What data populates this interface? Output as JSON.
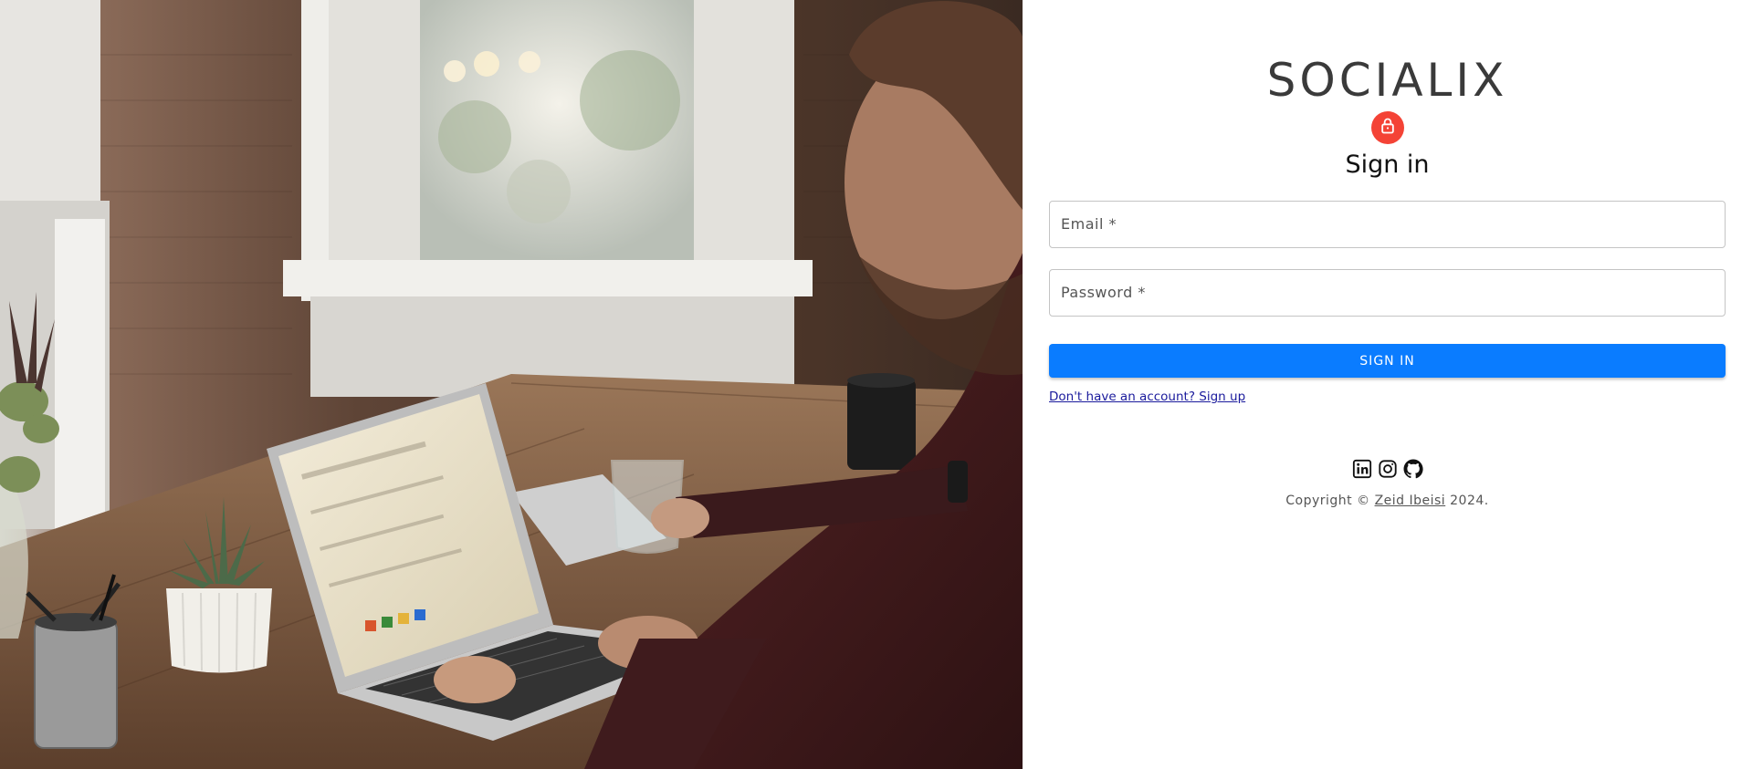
{
  "brand": {
    "name": "SOCIALIX"
  },
  "auth": {
    "title": "Sign in",
    "avatar_icon": "lock-icon",
    "avatar_color": "#f44336",
    "email_label": "Email *",
    "email_value": "",
    "password_label": "Password *",
    "password_value": "",
    "submit_label": "SIGN IN",
    "submit_color": "#0a7cff",
    "signup_link": "Don't have an account? Sign up"
  },
  "footer": {
    "social_icons": [
      "linkedin-icon",
      "instagram-icon",
      "github-icon"
    ],
    "copyright_prefix": "Copyright © ",
    "author": "Zeid Ibeisi",
    "copyright_suffix": " 2024."
  },
  "hero_image": {
    "description_icon": "workspace-photo"
  }
}
